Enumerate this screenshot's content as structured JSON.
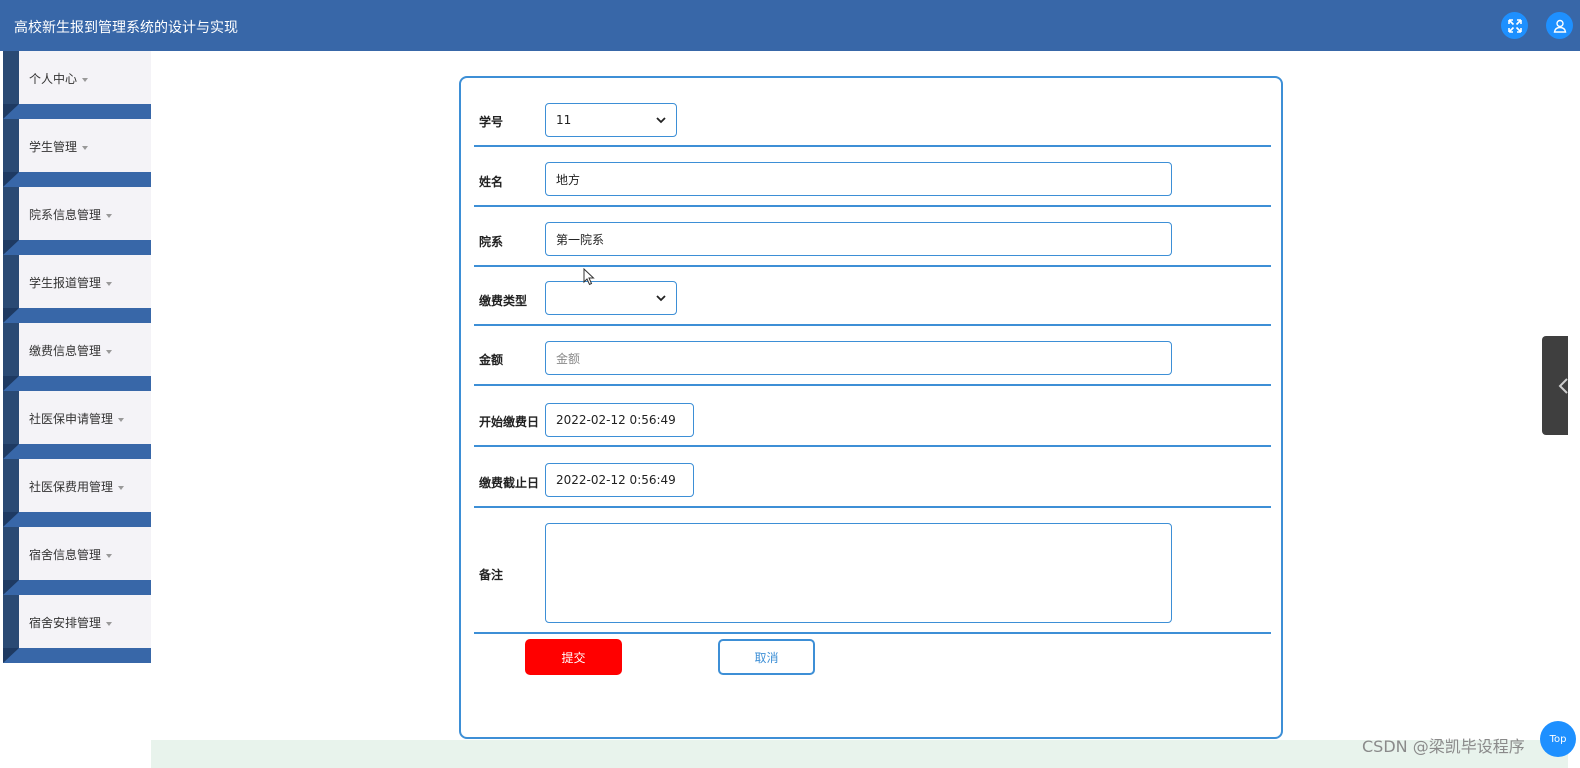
{
  "app": {
    "title": "高校新生报到管理系统的设计与实现"
  },
  "header_icons": [
    "expand-icon",
    "user-icon"
  ],
  "sidebar": {
    "items": [
      {
        "label": "个人中心"
      },
      {
        "label": "学生管理"
      },
      {
        "label": "院系信息管理"
      },
      {
        "label": "学生报道管理"
      },
      {
        "label": "缴费信息管理"
      },
      {
        "label": "社医保申请管理"
      },
      {
        "label": "社医保费用管理"
      },
      {
        "label": "宿舍信息管理"
      },
      {
        "label": "宿舍安排管理"
      }
    ]
  },
  "form": {
    "student_id": {
      "label": "学号",
      "value": "11"
    },
    "name": {
      "label": "姓名",
      "value": "地方"
    },
    "department": {
      "label": "院系",
      "value": "第一院系"
    },
    "fee_type": {
      "label": "缴费类型",
      "value": ""
    },
    "amount": {
      "label": "金额",
      "placeholder": "金额"
    },
    "start_date": {
      "label": "开始缴费日",
      "value": "2022-02-12 0:56:49"
    },
    "end_date": {
      "label": "缴费截止日",
      "value": "2022-02-12 0:56:49"
    },
    "remark": {
      "label": "备注",
      "value": ""
    },
    "submit_label": "提交",
    "cancel_label": "取消"
  },
  "float": {
    "top_label": "Top"
  },
  "watermark": "CSDN @梁凯毕设程序",
  "colors": {
    "header": "#3867a8",
    "accent": "#3d8fd6",
    "submit": "#ff0000"
  }
}
